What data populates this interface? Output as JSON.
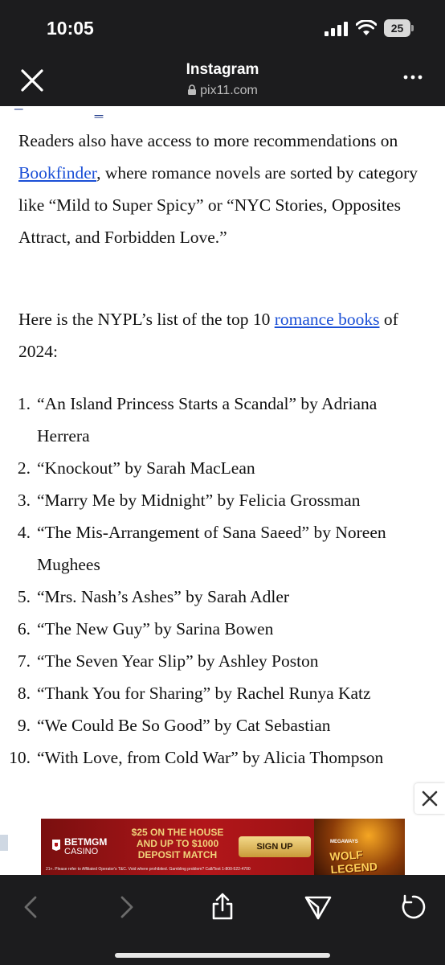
{
  "status_bar": {
    "time": "10:05",
    "battery": "25"
  },
  "browser": {
    "title": "Instagram",
    "url": "pix11.com"
  },
  "article": {
    "para1": {
      "before": "Readers also have access to more recommendations on ",
      "link": "Bookfinder",
      "after": ", where romance novels are sorted by category like “Mild to Super Spicy” or “NYC Stories, Opposites Attract, and Forbidden Love.”"
    },
    "para2": {
      "before": "Here is the NYPL’s list of the top 10 ",
      "link": "romance books",
      "after": " of 2024:"
    },
    "books": [
      {
        "num": "1.",
        "text": "“An Island Princess Starts a Scandal” by Adriana Herrera"
      },
      {
        "num": "2.",
        "text": "“Knockout” by Sarah MacLean"
      },
      {
        "num": "3.",
        "text": "“Marry Me by Midnight” by Felicia Grossman"
      },
      {
        "num": "4.",
        "text": "“The Mis-Arrangement of Sana Saeed” by Noreen Mughees"
      },
      {
        "num": "5.",
        "text": "“Mrs. Nash’s Ashes” by Sarah Adler"
      },
      {
        "num": "6.",
        "text": "“The New Guy” by Sarina Bowen"
      },
      {
        "num": "7.",
        "text": "“The Seven Year Slip” by Ashley Poston"
      },
      {
        "num": "8.",
        "text": "“Thank You for Sharing” by Rachel Runya Katz"
      },
      {
        "num": "9.",
        "text": "“We Could Be So Good” by Cat Sebastian"
      },
      {
        "num": "10.",
        "text": "“With Love, from Cold War” by Alicia Thompson"
      }
    ]
  },
  "ad": {
    "brand": "BETMGM",
    "casino": "CASINO",
    "offer_line1": "$25 ON THE HOUSE",
    "offer_line2": "AND UP TO $1000",
    "offer_line3": "DEPOSIT MATCH",
    "cta": "SIGN UP",
    "game_sub": "MEGAWAYS",
    "game_title": "WOLF LEGEND",
    "disclaimer": "21+. Please refer to Affiliated Operator's T&C. Void where prohibited. Gambling problem? Call/Text 1-800-522-4700"
  },
  "colors": {
    "link": "#1a4fd6",
    "chrome": "#1c1c1e",
    "ad_red": "#b2161a",
    "ad_gold": "#f0d27a"
  },
  "icons": [
    "close-icon",
    "lock-icon",
    "more-icon",
    "back-icon",
    "forward-icon",
    "share-icon",
    "send-icon",
    "reload-icon",
    "ad-close-icon"
  ]
}
